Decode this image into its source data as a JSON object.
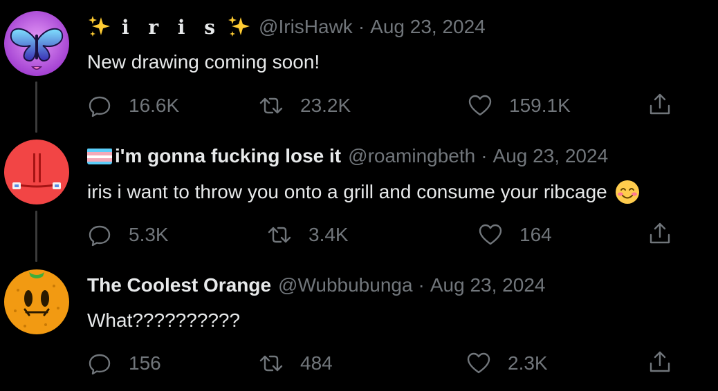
{
  "tweets": [
    {
      "name_text": "i r i s",
      "handle": "@IrisHawk",
      "separator": "·",
      "date": "Aug 23, 2024",
      "text": "New drawing coming soon!",
      "replies": "16.6K",
      "retweets": "23.2K",
      "likes": "159.1K",
      "avatar_icon": "butterfly-avatar",
      "accent": "#c95fe8"
    },
    {
      "name_text": "i'm gonna fucking lose it",
      "handle": "@roamingbeth",
      "separator": "·",
      "date": "Aug 23, 2024",
      "text": "iris i want to throw you onto a grill and consume your ribcage",
      "replies": "5.3K",
      "retweets": "3.4K",
      "likes": "164",
      "avatar_icon": "red-face-avatar",
      "accent": "#f24545"
    },
    {
      "name_text": "The Coolest Orange",
      "handle": "@Wubbubunga",
      "separator": "·",
      "date": "Aug 23, 2024",
      "text": "What??????????",
      "replies": "156",
      "retweets": "484",
      "likes": "2.3K",
      "avatar_icon": "orange-avatar",
      "accent": "#f29a12"
    }
  ],
  "icons": {
    "reply": "reply-icon",
    "retweet": "retweet-icon",
    "like": "heart-icon",
    "share": "share-icon"
  },
  "colors": {
    "background": "#000000",
    "text": "#e7e9ea",
    "muted": "#71767b"
  }
}
